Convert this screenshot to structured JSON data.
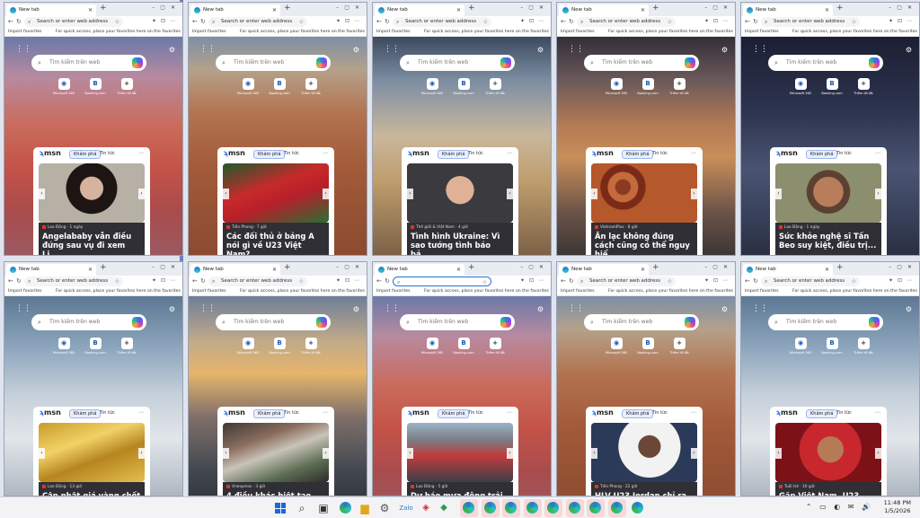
{
  "browser": {
    "tab_title": "New tab",
    "address_placeholder": "Search or enter web address",
    "import_favorites": "Import favorites",
    "fav_hint": "For quick access, place your favorites here on the favorites bar."
  },
  "newtab": {
    "search_placeholder": "Tìm kiếm trên web",
    "tiles": [
      "Microsoft 365",
      "Booking.com",
      "Thêm lối tắt"
    ],
    "msn_logo": "msn",
    "tab_kham_pha": "Khám phá",
    "tab_tin_tuc": "Tin tức"
  },
  "windows": [
    {
      "bg": "canyon",
      "photo": "woman",
      "source": "Lao Động · 1 ngày",
      "headline": "Angelababy vẫn điều đứng sau vụ đi xem Li..."
    },
    {
      "bg": "dunes",
      "photo": "soccer",
      "source": "Tiền Phong · 7 giờ",
      "headline": "Các đối thủ ở bảng A nói gì về U23 Việt Nam?"
    },
    {
      "bg": "cactus",
      "photo": "man",
      "source": "Thế giới & Việt Nam · 4 giờ",
      "headline": "Tình hình Ukraine: Vì sao tướng tình báo bả..."
    },
    {
      "bg": "sunset",
      "photo": "beans",
      "source": "VietnamPlus · 8 giờ",
      "headline": "Ăn lạc không đúng cách cũng có thể nguy hiể..."
    },
    {
      "bg": "stars",
      "photo": "actor",
      "source": "Lao Động · 1 ngày",
      "headline": "Sức khỏe nghệ sĩ Tấn Beo suy kiệt, điều trị..."
    },
    {
      "bg": "mount",
      "photo": "gold",
      "source": "Lao Động · 13 giờ",
      "headline": "Cập nhật giá vàng chốt"
    },
    {
      "bg": "sun2",
      "photo": "money",
      "source": "Vnexpress · 3 giờ",
      "headline": "4 điều khác biệt tạo nên"
    },
    {
      "bg": "canyon",
      "photo": "traffic",
      "source": "Lao Động · 5 giờ",
      "headline": "Dự báo mưa đông trải"
    },
    {
      "bg": "dunes",
      "photo": "jordan",
      "source": "Tiền Phong · 22 giờ",
      "headline": "HLV U23 Jordan chỉ ra"
    },
    {
      "bg": "mount",
      "photo": "player",
      "source": "Tuổi trẻ · 10 giờ",
      "headline": "Gặp Việt Nam, U23"
    }
  ],
  "taskbar": {
    "time": "11:48 PM",
    "date": "1/5/2026"
  },
  "colors": {
    "accent": "#1769d9",
    "taskbar_highlight": "#f7d7d7"
  }
}
